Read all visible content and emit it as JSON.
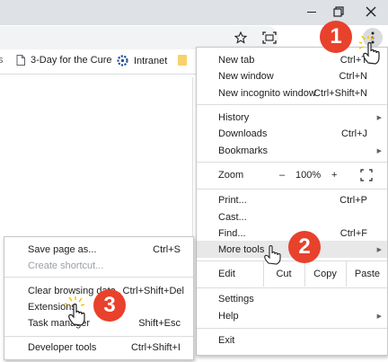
{
  "bookmarks": [
    {
      "icon": "page-icon",
      "label": "3-Day for the Cure"
    },
    {
      "icon": "intranet-logo-icon",
      "label": "Intranet"
    },
    {
      "icon": "folder-icon",
      "label": ""
    }
  ],
  "main_menu": {
    "new_tab": {
      "label": "New tab",
      "shortcut": "Ctrl+T"
    },
    "new_window": {
      "label": "New window",
      "shortcut": "Ctrl+N"
    },
    "new_incognito": {
      "label": "New incognito window",
      "shortcut": "Ctrl+Shift+N"
    },
    "history": {
      "label": "History"
    },
    "downloads": {
      "label": "Downloads",
      "shortcut": "Ctrl+J"
    },
    "bookmarks": {
      "label": "Bookmarks"
    },
    "zoom": {
      "label": "Zoom",
      "minus": "–",
      "value": "100%",
      "plus": "+"
    },
    "print": {
      "label": "Print...",
      "shortcut": "Ctrl+P"
    },
    "cast": {
      "label": "Cast..."
    },
    "find": {
      "label": "Find...",
      "shortcut": "Ctrl+F"
    },
    "more_tools": {
      "label": "More tools"
    },
    "edit": {
      "label": "Edit",
      "cut": "Cut",
      "copy": "Copy",
      "paste": "Paste"
    },
    "settings": {
      "label": "Settings"
    },
    "help": {
      "label": "Help"
    },
    "exit": {
      "label": "Exit"
    }
  },
  "sub_menu": {
    "save_page": {
      "label": "Save page as...",
      "shortcut": "Ctrl+S"
    },
    "create_shortcut": {
      "label": "Create shortcut..."
    },
    "clear_browsing": {
      "label": "Clear browsing data...",
      "shortcut": "Ctrl+Shift+Del"
    },
    "extensions": {
      "label": "Extensions"
    },
    "task_manager": {
      "label": "Task manager",
      "shortcut": "Shift+Esc"
    },
    "developer_tools": {
      "label": "Developer tools",
      "shortcut": "Ctrl+Shift+I"
    }
  },
  "step_badges": [
    "1",
    "2",
    "3"
  ],
  "colors": {
    "badge": "#e8412c",
    "highlight": "#e8e8e8",
    "titlebar": "#dee1e6",
    "cursor_burst": "#f5c400"
  }
}
